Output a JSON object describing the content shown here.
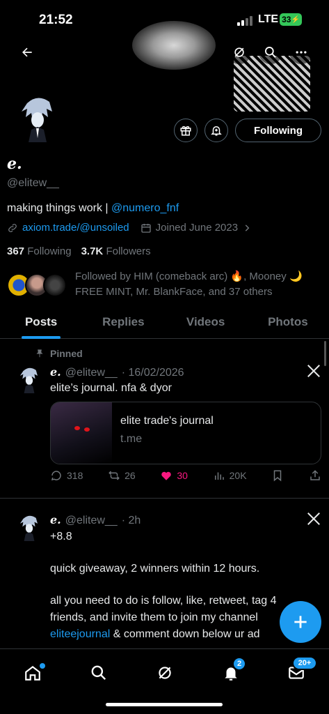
{
  "status": {
    "time": "21:52",
    "network": "LTE",
    "battery": "33"
  },
  "profile": {
    "display_name": "e.",
    "handle": "@elitew__",
    "bio_text": "making things work | ",
    "bio_mention": "@numero_fnf",
    "website": "axiom.trade/@unsoiled",
    "joined": "Joined June 2023",
    "following_count": "367",
    "following_label": "Following",
    "followers_count": "3.7K",
    "followers_label": "Followers",
    "following_button": "Following",
    "followed_by": "Followed by HIM (comeback arc) 🔥, Mooney 🌙 FREE MINT, Mr. BlankFace, and 37 others"
  },
  "tabs": [
    {
      "label": "Posts",
      "active": true
    },
    {
      "label": "Replies"
    },
    {
      "label": "Videos"
    },
    {
      "label": "Photos"
    }
  ],
  "posts": [
    {
      "pinned_label": "Pinned",
      "name": "e.",
      "handle": "@elitew__",
      "time": "· 16/02/2026",
      "text": "elite’s journal. nfa & dyor",
      "card": {
        "title": "elite trade's journal",
        "domain": "t.me"
      },
      "replies": "318",
      "reposts": "26",
      "likes": "30",
      "views": "20K"
    },
    {
      "name": "e.",
      "handle": "@elitew__",
      "time": "· 2h",
      "line1": "+8.8",
      "line2": "quick giveaway, 2 winners within 12 hours.",
      "line3": "all you need to do is follow, like, retweet, tag 4",
      "line4": "friends, and invite them to join my channel",
      "line5_link": "eliteejournal",
      "line5_rest": " & comment down below ur ad"
    }
  ],
  "nav": {
    "notifications_badge": "2",
    "messages_badge": "20+"
  },
  "colors": {
    "accent": "#1d9bf0",
    "like": "#f91880",
    "background": "#000000"
  }
}
